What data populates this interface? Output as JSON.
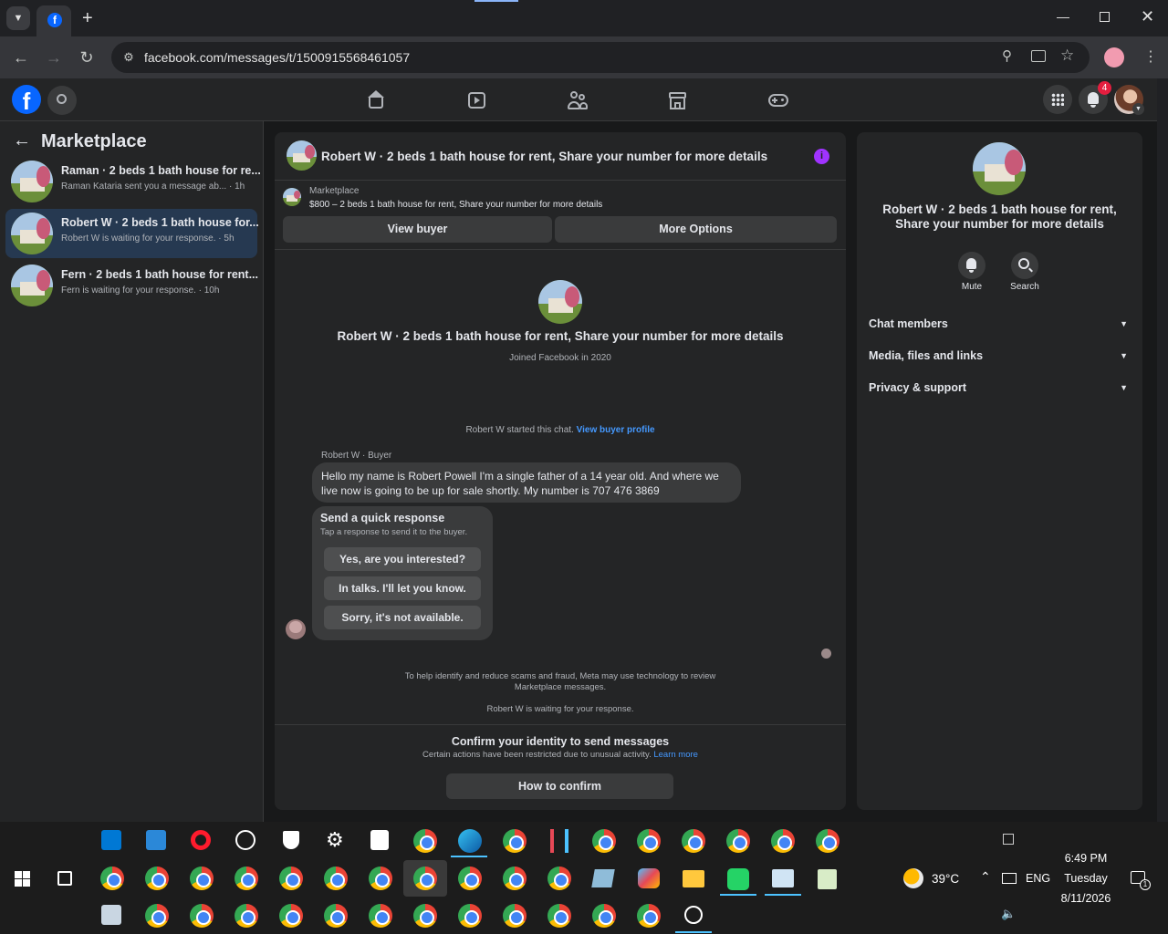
{
  "browser": {
    "url": "facebook.com/messages/t/1500915568461057",
    "icons": [
      "tab-search-icon",
      "facebook-favicon",
      "new-tab-icon",
      "minimize-icon",
      "restore-icon",
      "close-icon",
      "back-icon",
      "forward-icon",
      "reload-icon",
      "site-info-icon",
      "zoom-icon",
      "install-icon",
      "bookmark-star-icon",
      "profile-avatar",
      "menu-icon"
    ]
  },
  "fb_header": {
    "notifications_count": "4",
    "nav_icons": [
      "home-icon",
      "video-icon",
      "groups-icon",
      "marketplace-icon",
      "gaming-icon"
    ]
  },
  "sidebar": {
    "title": "Marketplace",
    "conversations": [
      {
        "title": "Raman · 2 beds 1 bath house for re...",
        "subtitle": "Raman Kataria sent you a message ab... · 1h"
      },
      {
        "title": "Robert W · 2 beds 1 bath house for...",
        "subtitle": "Robert W is waiting for your response. · 5h"
      },
      {
        "title": "Fern · 2 beds 1 bath house for rent...",
        "subtitle": "Fern is waiting for your response. · 10h"
      }
    ]
  },
  "chat": {
    "header_title": "Robert W · 2 beds 1 bath house for rent, Share your number for more details",
    "listing_label": "Marketplace",
    "listing_desc": "$800 – 2 beds 1 bath house for rent, Share your number for more details",
    "view_buyer": "View buyer",
    "more_options": "More Options",
    "profile_title": "Robert W · 2 beds 1 bath house for rent, Share your number for more details",
    "joined": "Joined Facebook in 2020",
    "started_text": "Robert W started this chat.",
    "view_buyer_profile": "View buyer profile",
    "sender_label": "Robert W · Buyer",
    "message": "Hello my name is Robert Powell I'm a single father of a 14 year old. And where we live now is going to be up for sale shortly. My number is 707 476 3869",
    "quick_title": "Send a quick response",
    "quick_sub": "Tap a response to send it to the buyer.",
    "quick_options": [
      "Yes, are you interested?",
      "In talks. I'll let you know.",
      "Sorry, it's not available."
    ],
    "scam_notice": "To help identify and reduce scams and fraud, Meta may use technology to review Marketplace messages.",
    "waiting": "Robert W is waiting for your response.",
    "confirm_title": "Confirm your identity to send messages",
    "confirm_sub": "Certain actions have been restricted due to unusual activity.",
    "learn_more": "Learn more",
    "how_to_confirm": "How to confirm"
  },
  "details": {
    "title": "Robert W · 2 beds 1 bath house for rent, Share your number for more details",
    "mute": "Mute",
    "search": "Search",
    "sections": [
      "Chat members",
      "Media, files and links",
      "Privacy & support"
    ]
  },
  "taskbar": {
    "weather": "39°C",
    "lang": "ENG",
    "time": "6:49 PM",
    "day": "Tuesday",
    "date": "8/11/2026",
    "notif_count": "1"
  },
  "colors": {
    "accent": "#0866ff",
    "link": "#4599ff",
    "badge": "#e41e3f",
    "info": "#a033ff"
  }
}
